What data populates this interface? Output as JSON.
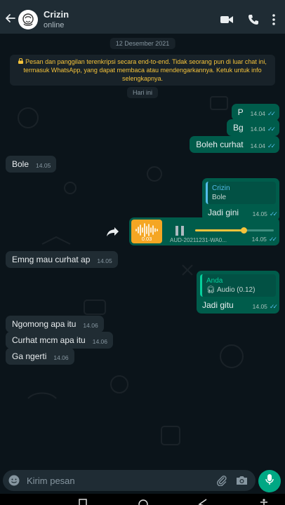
{
  "contact": {
    "name": "Crizin",
    "status": "online"
  },
  "icons": {
    "back": "back-arrow-icon",
    "video": "video-call-icon",
    "call": "phone-call-icon",
    "emoji": "emoji-icon",
    "attach": "attach-icon",
    "camera": "camera-icon",
    "mic": "mic-icon"
  },
  "colors": {
    "header_bg": "#1f2c34",
    "chat_bg": "#0b141a",
    "outgoing": "#005c4b",
    "incoming": "#202c33",
    "accent": "#00a884",
    "read_ticks": "#53bdeb",
    "system_text": "#f5c33b"
  },
  "chat": {
    "date_old": "12 Desember 2021",
    "encryption_notice": "Pesan dan panggilan terenkripsi secara end-to-end. Tidak seorang pun di luar chat ini, termasuk WhatsApp, yang dapat membaca atau mendengarkannya. Ketuk untuk info selengkapnya.",
    "date_today": "Hari ini",
    "messages": [
      {
        "dir": "out",
        "text": "P",
        "time": "14.04"
      },
      {
        "dir": "out",
        "text": "Bg",
        "time": "14.04"
      },
      {
        "dir": "out",
        "text": "Boleh curhat",
        "time": "14.04"
      },
      {
        "dir": "in",
        "text": "Bole",
        "time": "14.05"
      },
      {
        "dir": "out",
        "text": "Jadi gini",
        "time": "14.05",
        "quote_name": "Crizin",
        "quote_text": "Bole"
      },
      {
        "dir": "out",
        "type": "audio",
        "duration": "0.03",
        "filename": "AUD-20211231-WA0...",
        "time": "14.05",
        "progress": 0.62
      },
      {
        "dir": "in",
        "text": "Emng mau curhat ap",
        "time": "14.05"
      },
      {
        "dir": "out",
        "text": "Jadi gitu",
        "time": "14.05",
        "quote_name": "Anda",
        "quote_text": "Audio (0.12)"
      },
      {
        "dir": "in",
        "text": "Ngomong apa itu",
        "time": "14.06"
      },
      {
        "dir": "in",
        "text": "Curhat mcm apa itu",
        "time": "14.06"
      },
      {
        "dir": "in",
        "text": "Ga ngerti",
        "time": "14.06"
      }
    ]
  },
  "composer": {
    "placeholder": "Kirim pesan"
  }
}
